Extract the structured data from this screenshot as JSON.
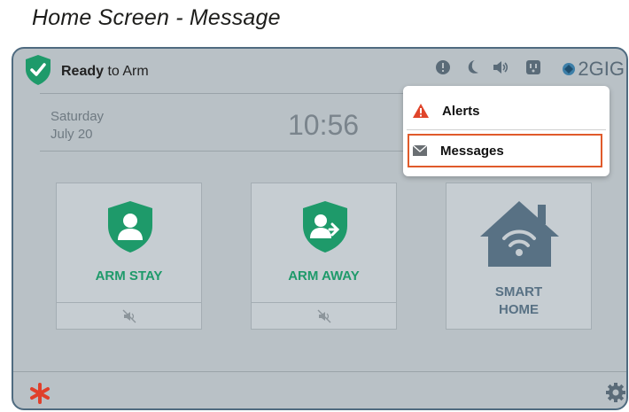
{
  "doc_title": "Home Screen - Message",
  "status": {
    "bold": "Ready",
    "rest": " to Arm"
  },
  "top_icons": [
    "alert-circle-icon",
    "moon-icon",
    "speaker-icon",
    "outlet-icon"
  ],
  "brand": "2GIG",
  "date": {
    "day": "Saturday",
    "date": "July 20"
  },
  "clock": "10:56",
  "menu": {
    "alerts_label": "Alerts",
    "messages_label": "Messages"
  },
  "tiles": {
    "arm_stay": {
      "label": "ARM STAY"
    },
    "arm_away": {
      "label": "ARM AWAY"
    },
    "smart_home": {
      "line1": "SMART",
      "line2": "HOME"
    }
  },
  "colors": {
    "accent_green": "#1e9a6a",
    "alert_red": "#e0452b",
    "highlight_orange": "#e05a2b",
    "panel_bg": "#b9c1c6",
    "smart_home_blue": "#587184"
  }
}
